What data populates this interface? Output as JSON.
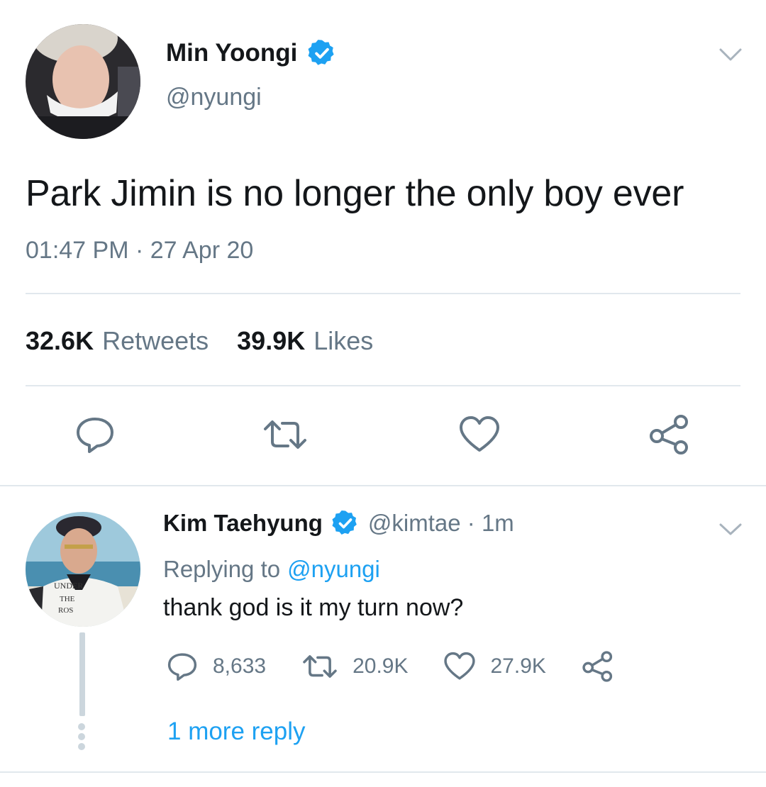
{
  "main_tweet": {
    "display_name": "Min Yoongi",
    "handle": "@nyungi",
    "text": "Park Jimin is no longer the only boy ever",
    "timestamp": "01:47 PM · 27 Apr 20",
    "stats": {
      "retweets_count": "32.6K",
      "retweets_label": "Retweets",
      "likes_count": "39.9K",
      "likes_label": "Likes"
    },
    "actions": [
      "reply-icon",
      "retweet-icon",
      "like-icon",
      "share-icon"
    ]
  },
  "reply_tweet": {
    "display_name": "Kim Taehyung",
    "handle_time": "@kimtae · 1m",
    "replying_to_label": "Replying to",
    "replying_to_handle": "@nyungi",
    "text": "thank god is it my turn now?",
    "counts": {
      "replies": "8,633",
      "retweets": "20.9K",
      "likes": "27.9K"
    },
    "avatar_shirt_text": [
      "UNDER",
      "THE",
      "ROS"
    ]
  },
  "more_replies_link": "1 more reply",
  "colors": {
    "accent": "#1da1f2",
    "text_primary": "#14171a",
    "text_secondary": "#657786",
    "icon": "#657786",
    "divider": "#e1e8ed"
  }
}
